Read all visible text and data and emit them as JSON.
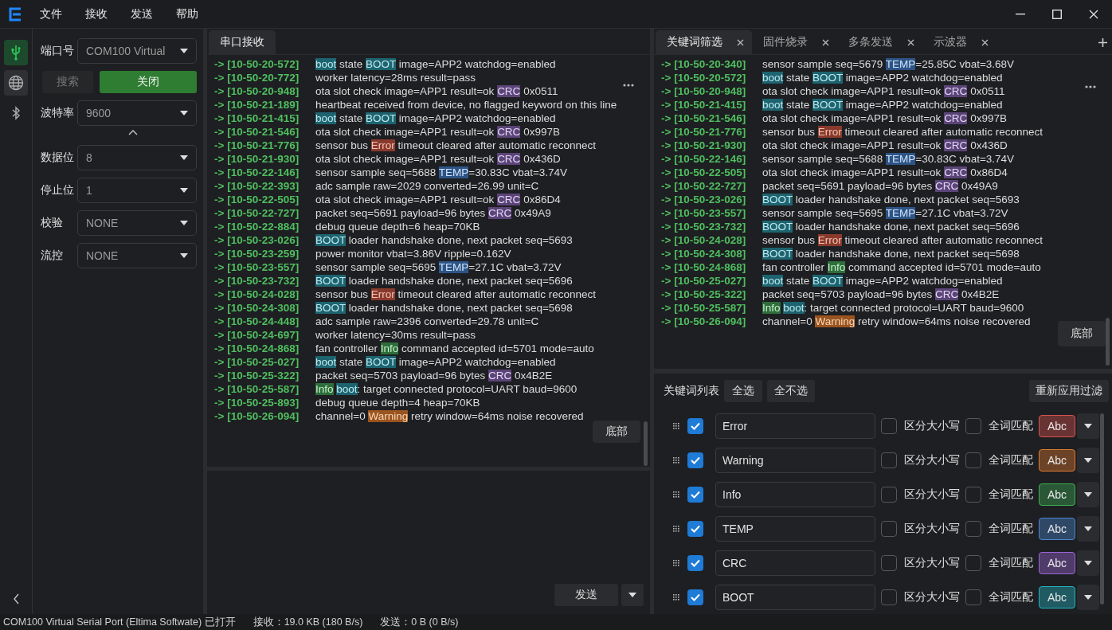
{
  "menu": [
    "文件",
    "接收",
    "发送",
    "帮助"
  ],
  "rail": [
    {
      "kind": "usb",
      "selected": true
    },
    {
      "kind": "globe",
      "selected": false
    },
    {
      "kind": "bluetooth",
      "selected": false
    }
  ],
  "settings": {
    "port": {
      "label": "端口号",
      "value": "COM100 Virtual"
    },
    "search_button": "搜索",
    "close_button": "关闭",
    "fields": [
      {
        "label": "波特率",
        "value": "9600"
      },
      {
        "label": "数据位",
        "value": "8"
      },
      {
        "label": "停止位",
        "value": "1"
      },
      {
        "label": "校验",
        "value": "NONE"
      },
      {
        "label": "流控",
        "value": "NONE"
      }
    ]
  },
  "receive": {
    "tab": "串口接收",
    "bottom_button": "底部",
    "lines": [
      {
        "time": "-> [10-50-20-572]",
        "parts": [
          {
            "text": "boot",
            "kind": "boot"
          },
          {
            "text": " state "
          },
          {
            "text": "BOOT",
            "kind": "boot"
          },
          {
            "text": " image=APP2 watchdog=enabled"
          }
        ]
      },
      {
        "time": "-> [10-50-20-772]",
        "parts": [
          {
            "text": "worker latency=28ms result=pass"
          }
        ]
      },
      {
        "time": "-> [10-50-20-948]",
        "parts": [
          {
            "text": "ota slot check image=APP1 result=ok "
          },
          {
            "text": "CRC",
            "kind": "crc"
          },
          {
            "text": " 0x0511"
          }
        ]
      },
      {
        "time": "-> [10-50-21-189]",
        "parts": [
          {
            "text": "heartbeat received from device, no flagged keyword on this line"
          }
        ]
      },
      {
        "time": "-> [10-50-21-415]",
        "parts": [
          {
            "text": "boot",
            "kind": "boot"
          },
          {
            "text": " state "
          },
          {
            "text": "BOOT",
            "kind": "boot"
          },
          {
            "text": " image=APP2 watchdog=enabled"
          }
        ]
      },
      {
        "time": "-> [10-50-21-546]",
        "parts": [
          {
            "text": "ota slot check image=APP1 result=ok "
          },
          {
            "text": "CRC",
            "kind": "crc"
          },
          {
            "text": " 0x997B"
          }
        ]
      },
      {
        "time": "-> [10-50-21-776]",
        "parts": [
          {
            "text": "sensor bus "
          },
          {
            "text": "Error",
            "kind": "error"
          },
          {
            "text": " timeout cleared after automatic reconnect"
          }
        ]
      },
      {
        "time": "-> [10-50-21-930]",
        "parts": [
          {
            "text": "ota slot check image=APP1 result=ok "
          },
          {
            "text": "CRC",
            "kind": "crc"
          },
          {
            "text": " 0x436D"
          }
        ]
      },
      {
        "time": "-> [10-50-22-146]",
        "parts": [
          {
            "text": "sensor sample seq=5688 "
          },
          {
            "text": "TEMP",
            "kind": "temp"
          },
          {
            "text": "=30.83C vbat=3.74V"
          }
        ]
      },
      {
        "time": "-> [10-50-22-393]",
        "parts": [
          {
            "text": "adc sample raw=2029 converted=26.99 unit=C"
          }
        ]
      },
      {
        "time": "-> [10-50-22-505]",
        "parts": [
          {
            "text": "ota slot check image=APP1 result=ok "
          },
          {
            "text": "CRC",
            "kind": "crc"
          },
          {
            "text": " 0x86D4"
          }
        ]
      },
      {
        "time": "-> [10-50-22-727]",
        "parts": [
          {
            "text": "packet seq=5691 payload=96 bytes "
          },
          {
            "text": "CRC",
            "kind": "crc"
          },
          {
            "text": " 0x49A9"
          }
        ]
      },
      {
        "time": "-> [10-50-22-884]",
        "parts": [
          {
            "text": "debug queue depth=6 heap=70KB"
          }
        ]
      },
      {
        "time": "-> [10-50-23-026]",
        "parts": [
          {
            "text": "BOOT",
            "kind": "boot"
          },
          {
            "text": " loader handshake done, next packet seq=5693"
          }
        ]
      },
      {
        "time": "-> [10-50-23-259]",
        "parts": [
          {
            "text": "power monitor vbat=3.86V ripple=0.162V"
          }
        ]
      },
      {
        "time": "-> [10-50-23-557]",
        "parts": [
          {
            "text": "sensor sample seq=5695 "
          },
          {
            "text": "TEMP",
            "kind": "temp"
          },
          {
            "text": "=27.1C vbat=3.72V"
          }
        ]
      },
      {
        "time": "-> [10-50-23-732]",
        "parts": [
          {
            "text": "BOOT",
            "kind": "boot"
          },
          {
            "text": " loader handshake done, next packet seq=5696"
          }
        ]
      },
      {
        "time": "-> [10-50-24-028]",
        "parts": [
          {
            "text": "sensor bus "
          },
          {
            "text": "Error",
            "kind": "error"
          },
          {
            "text": " timeout cleared after automatic reconnect"
          }
        ]
      },
      {
        "time": "-> [10-50-24-308]",
        "parts": [
          {
            "text": "BOOT",
            "kind": "boot"
          },
          {
            "text": " loader handshake done, next packet seq=5698"
          }
        ]
      },
      {
        "time": "-> [10-50-24-448]",
        "parts": [
          {
            "text": "adc sample raw=2396 converted=29.78 unit=C"
          }
        ]
      },
      {
        "time": "-> [10-50-24-697]",
        "parts": [
          {
            "text": "worker latency=30ms result=pass"
          }
        ]
      },
      {
        "time": "-> [10-50-24-868]",
        "parts": [
          {
            "text": "fan controller "
          },
          {
            "text": "Info",
            "kind": "info"
          },
          {
            "text": " command accepted id=5701 mode=auto"
          }
        ]
      },
      {
        "time": "-> [10-50-25-027]",
        "parts": [
          {
            "text": "boot",
            "kind": "boot"
          },
          {
            "text": " state "
          },
          {
            "text": "BOOT",
            "kind": "boot"
          },
          {
            "text": " image=APP2 watchdog=enabled"
          }
        ]
      },
      {
        "time": "-> [10-50-25-322]",
        "parts": [
          {
            "text": "packet seq=5703 payload=96 bytes "
          },
          {
            "text": "CRC",
            "kind": "crc"
          },
          {
            "text": " 0x4B2E"
          }
        ]
      },
      {
        "time": "-> [10-50-25-587]",
        "parts": [
          {
            "text": "Info",
            "kind": "info",
            "space_after": true
          },
          {
            "text": "boot",
            "kind": "boot"
          },
          {
            "text": ": target connected protocol=UART baud=9600"
          }
        ]
      },
      {
        "time": "-> [10-50-25-893]",
        "parts": [
          {
            "text": "debug queue depth=4 heap=70KB"
          }
        ]
      },
      {
        "time": "-> [10-50-26-094]",
        "parts": [
          {
            "text": "channel=0 "
          },
          {
            "text": "Warning",
            "kind": "warning"
          },
          {
            "text": " retry window=64ms noise recovered"
          }
        ]
      }
    ]
  },
  "send": {
    "button": "发送"
  },
  "tabs": [
    {
      "label": "关键词筛选",
      "selected": true
    },
    {
      "label": "固件烧录",
      "selected": false
    },
    {
      "label": "多条发送",
      "selected": false
    },
    {
      "label": "示波器",
      "selected": false
    }
  ],
  "filtered": {
    "bottom_button": "底部",
    "lines": [
      {
        "time": "-> [10-50-20-340]",
        "parts": [
          {
            "text": "sensor sample seq=5679 "
          },
          {
            "text": "TEMP",
            "kind": "temp"
          },
          {
            "text": "=25.85C vbat=3.68V"
          }
        ]
      },
      {
        "time": "-> [10-50-20-572]",
        "parts": [
          {
            "text": "boot",
            "kind": "boot"
          },
          {
            "text": " state "
          },
          {
            "text": "BOOT",
            "kind": "boot"
          },
          {
            "text": " image=APP2 watchdog=enabled"
          }
        ]
      },
      {
        "time": "-> [10-50-20-948]",
        "parts": [
          {
            "text": "ota slot check image=APP1 result=ok "
          },
          {
            "text": "CRC",
            "kind": "crc"
          },
          {
            "text": " 0x0511"
          }
        ]
      },
      {
        "time": "-> [10-50-21-415]",
        "parts": [
          {
            "text": "boot",
            "kind": "boot"
          },
          {
            "text": " state "
          },
          {
            "text": "BOOT",
            "kind": "boot"
          },
          {
            "text": " image=APP2 watchdog=enabled"
          }
        ]
      },
      {
        "time": "-> [10-50-21-546]",
        "parts": [
          {
            "text": "ota slot check image=APP1 result=ok "
          },
          {
            "text": "CRC",
            "kind": "crc"
          },
          {
            "text": " 0x997B"
          }
        ]
      },
      {
        "time": "-> [10-50-21-776]",
        "parts": [
          {
            "text": "sensor bus "
          },
          {
            "text": "Error",
            "kind": "error"
          },
          {
            "text": " timeout cleared after automatic reconnect"
          }
        ]
      },
      {
        "time": "-> [10-50-21-930]",
        "parts": [
          {
            "text": "ota slot check image=APP1 result=ok "
          },
          {
            "text": "CRC",
            "kind": "crc"
          },
          {
            "text": " 0x436D"
          }
        ]
      },
      {
        "time": "-> [10-50-22-146]",
        "parts": [
          {
            "text": "sensor sample seq=5688 "
          },
          {
            "text": "TEMP",
            "kind": "temp"
          },
          {
            "text": "=30.83C vbat=3.74V"
          }
        ]
      },
      {
        "time": "-> [10-50-22-505]",
        "parts": [
          {
            "text": "ota slot check image=APP1 result=ok "
          },
          {
            "text": "CRC",
            "kind": "crc"
          },
          {
            "text": " 0x86D4"
          }
        ]
      },
      {
        "time": "-> [10-50-22-727]",
        "parts": [
          {
            "text": "packet seq=5691 payload=96 bytes "
          },
          {
            "text": "CRC",
            "kind": "crc"
          },
          {
            "text": " 0x49A9"
          }
        ]
      },
      {
        "time": "-> [10-50-23-026]",
        "parts": [
          {
            "text": "BOOT",
            "kind": "boot"
          },
          {
            "text": " loader handshake done, next packet seq=5693"
          }
        ]
      },
      {
        "time": "-> [10-50-23-557]",
        "parts": [
          {
            "text": "sensor sample seq=5695 "
          },
          {
            "text": "TEMP",
            "kind": "temp"
          },
          {
            "text": "=27.1C vbat=3.72V"
          }
        ]
      },
      {
        "time": "-> [10-50-23-732]",
        "parts": [
          {
            "text": "BOOT",
            "kind": "boot"
          },
          {
            "text": " loader handshake done, next packet seq=5696"
          }
        ]
      },
      {
        "time": "-> [10-50-24-028]",
        "parts": [
          {
            "text": "sensor bus "
          },
          {
            "text": "Error",
            "kind": "error"
          },
          {
            "text": " timeout cleared after automatic reconnect"
          }
        ]
      },
      {
        "time": "-> [10-50-24-308]",
        "parts": [
          {
            "text": "BOOT",
            "kind": "boot"
          },
          {
            "text": " loader handshake done, next packet seq=5698"
          }
        ]
      },
      {
        "time": "-> [10-50-24-868]",
        "parts": [
          {
            "text": "fan controller "
          },
          {
            "text": "Info",
            "kind": "info"
          },
          {
            "text": " command accepted id=5701 mode=auto"
          }
        ]
      },
      {
        "time": "-> [10-50-25-027]",
        "parts": [
          {
            "text": "boot",
            "kind": "boot"
          },
          {
            "text": " state "
          },
          {
            "text": "BOOT",
            "kind": "boot"
          },
          {
            "text": " image=APP2 watchdog=enabled"
          }
        ]
      },
      {
        "time": "-> [10-50-25-322]",
        "parts": [
          {
            "text": "packet seq=5703 payload=96 bytes "
          },
          {
            "text": "CRC",
            "kind": "crc"
          },
          {
            "text": " 0x4B2E"
          }
        ]
      },
      {
        "time": "-> [10-50-25-587]",
        "parts": [
          {
            "text": "Info",
            "kind": "info",
            "space_after": true
          },
          {
            "text": "boot",
            "kind": "boot"
          },
          {
            "text": ": target connected protocol=UART baud=9600"
          }
        ]
      },
      {
        "time": "-> [10-50-26-094]",
        "parts": [
          {
            "text": "channel=0 "
          },
          {
            "text": "Warning",
            "kind": "warning"
          },
          {
            "text": " retry window=64ms noise recovered"
          }
        ]
      }
    ]
  },
  "keywords": {
    "title": "关键词列表",
    "select_all": "全选",
    "select_none": "全不选",
    "reapply": "重新应用过滤",
    "items": [
      {
        "enabled": true,
        "text": "Error",
        "case_label": "区分大小写",
        "case_sensitive": false,
        "word_label": "全词匹配",
        "whole_word": false,
        "color": "#d9534f",
        "sample": "Abc"
      },
      {
        "enabled": true,
        "text": "Warning",
        "case_label": "区分大小写",
        "case_sensitive": false,
        "word_label": "全词匹配",
        "whole_word": false,
        "color": "#e07b2e",
        "sample": "Abc"
      },
      {
        "enabled": true,
        "text": "Info",
        "case_label": "区分大小写",
        "case_sensitive": false,
        "word_label": "全词匹配",
        "whole_word": false,
        "color": "#3cb054",
        "sample": "Abc"
      },
      {
        "enabled": true,
        "text": "TEMP",
        "case_label": "区分大小写",
        "case_sensitive": false,
        "word_label": "全词匹配",
        "whole_word": false,
        "color": "#4a86d0",
        "sample": "Abc"
      },
      {
        "enabled": true,
        "text": "CRC",
        "case_label": "区分大小写",
        "case_sensitive": false,
        "word_label": "全词匹配",
        "whole_word": false,
        "color": "#9a66d6",
        "sample": "Abc"
      },
      {
        "enabled": true,
        "text": "BOOT",
        "case_label": "区分大小写",
        "case_sensitive": false,
        "word_label": "全词匹配",
        "whole_word": false,
        "color": "#22b3c4",
        "sample": "Abc"
      }
    ]
  },
  "status_bar": [
    "COM100 Virtual Serial Port (Eltima Softwate) 已打开",
    "接收：19.0 KB (180 B/s)",
    "发送：0 B (0 B/s)"
  ]
}
